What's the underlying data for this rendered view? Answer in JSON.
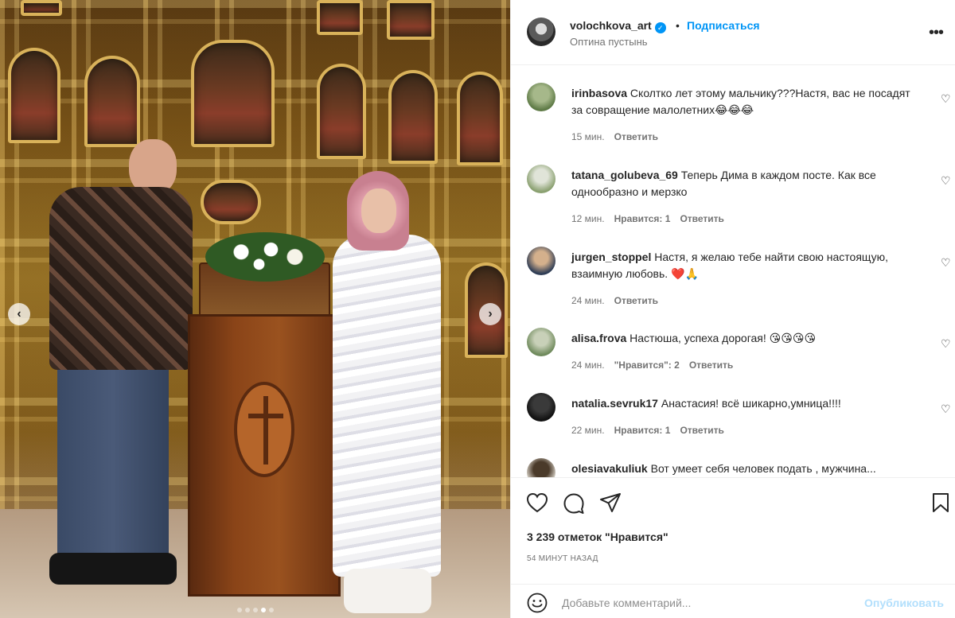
{
  "post": {
    "username": "volochkova_art",
    "separator": "•",
    "follow_label": "Подписаться",
    "location": "Оптина пустынь",
    "more_icon": "more-horizontal-icon",
    "carousel": {
      "slide_count": 5,
      "active_index": 3
    }
  },
  "comments": [
    {
      "user": "irinbasova",
      "text": "Сколтко лет этому мальчику???Настя, вас не посадят за совращение малолетних😂😂😂",
      "time": "15 мин.",
      "likes": "",
      "reply": "Ответить"
    },
    {
      "user": "tatana_golubeva_69",
      "text": "Теперь Дима в каждом посте. Как все однообразно и мерзко",
      "time": "12 мин.",
      "likes": "Нравится: 1",
      "reply": "Ответить"
    },
    {
      "user": "jurgen_stoppel",
      "text": "Настя, я желаю тебе найти свою настоящую, взаимную любовь. ❤️🙏",
      "time": "24 мин.",
      "likes": "",
      "reply": "Ответить"
    },
    {
      "user": "alisa.frova",
      "text": "Настюша, успеха дорогая!  😘😘😘😘",
      "time": "24 мин.",
      "likes": "\"Нравится\": 2",
      "reply": "Ответить"
    },
    {
      "user": "natalia.sevruk17",
      "text": "Анастасия! всё шикарно,умница!!!!",
      "time": "22 мин.",
      "likes": "Нравится: 1",
      "reply": "Ответить"
    },
    {
      "user": "olesiavakuliuk",
      "text": "Вот умеет себя человек подать , мужчина...",
      "time": "",
      "likes": "",
      "reply": ""
    }
  ],
  "actions": {
    "likes_count": "3 239 отметок \"Нравится\"",
    "time_ago": "54 МИНУТ НАЗАД"
  },
  "add_comment": {
    "placeholder": "Добавьте комментарий...",
    "publish_label": "Опубликовать"
  },
  "colors": {
    "accent": "#0095f6",
    "publish_disabled": "#b2dffc",
    "secondary_text": "#737373"
  }
}
